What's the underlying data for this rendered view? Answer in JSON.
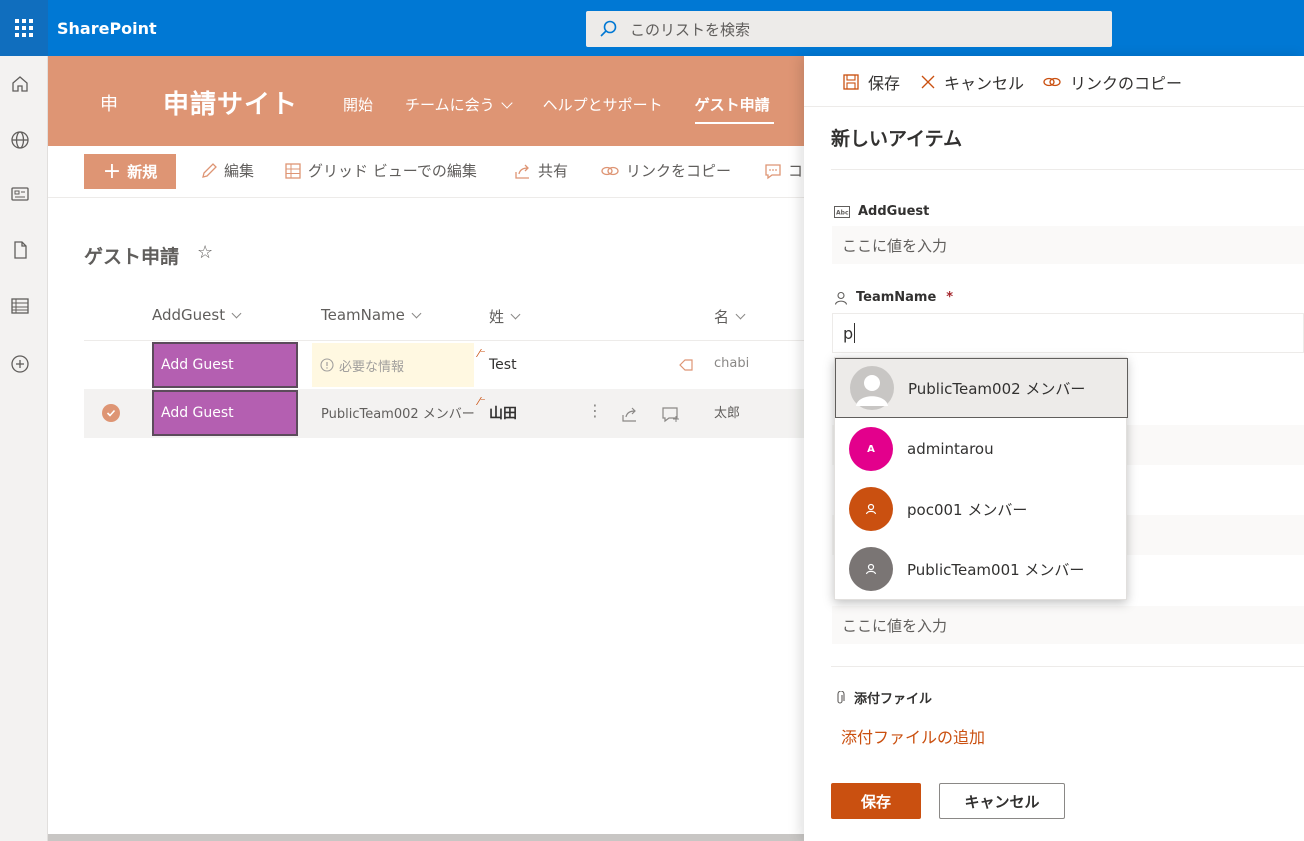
{
  "suitebar": {
    "brand": "SharePoint",
    "search_placeholder": "このリストを検索"
  },
  "site": {
    "logo_letter": "申",
    "title": "申請サイト",
    "nav": [
      {
        "label": "開始"
      },
      {
        "label": "チームに会う"
      },
      {
        "label": "ヘルプとサポート"
      },
      {
        "label": "ゲスト申請"
      }
    ]
  },
  "commandbar": {
    "new_label": "新規",
    "edit_label": "編集",
    "grid_label": "グリッド ビューでの編集",
    "share_label": "共有",
    "copy_link_label": "リンクをコピー",
    "comment_label": "コ"
  },
  "list": {
    "title": "ゲスト申請",
    "columns": [
      "AddGuest",
      "TeamName",
      "姓",
      "名"
    ],
    "rows": [
      {
        "add_guest": "Add Guest",
        "team_name": "必要な情報",
        "sei": "Test",
        "mei": "chabi"
      },
      {
        "add_guest": "Add Guest",
        "team_name": "PublicTeam002 メンバー",
        "sei": "山田",
        "mei": "太郎"
      }
    ]
  },
  "panel": {
    "save_label": "保存",
    "cancel_label": "キャンセル",
    "copy_link_label": "リンクのコピー",
    "title": "新しいアイテム",
    "fields": {
      "add_guest_label": "AddGuest",
      "add_guest_placeholder": "ここに値を入力",
      "team_name_label": "TeamName",
      "team_name_required": "*",
      "team_name_value": "p",
      "bottom_placeholder": "ここに値を入力",
      "attachments_label": "添付ファイル",
      "attachments_link": "添付ファイルの追加"
    },
    "footer": {
      "save_label": "保存",
      "cancel_label": "キャンセル"
    }
  },
  "suggestions": [
    {
      "name": "PublicTeam002 メンバー",
      "initials": "",
      "color": "#c8c6c4"
    },
    {
      "name": "admintarou",
      "initials": "A",
      "color": "#e3008c"
    },
    {
      "name": "poc001 メンバー",
      "initials": "",
      "color": "#ca5010"
    },
    {
      "name": "PublicTeam001 メンバー",
      "initials": "",
      "color": "#7a7574"
    }
  ],
  "colors": {
    "suite_blue": "#0078d4",
    "site_accent": "#de9574",
    "add_guest_purple": "#b45fb1",
    "primary_button": "#ca5010"
  }
}
